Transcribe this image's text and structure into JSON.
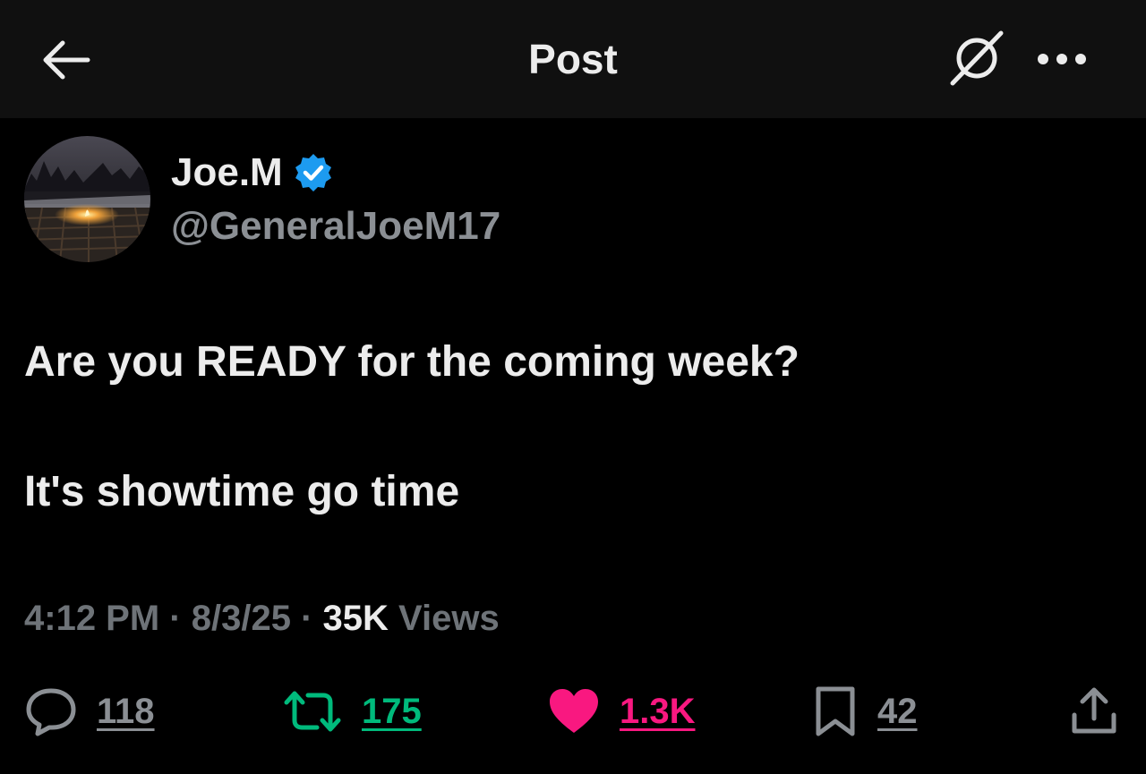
{
  "header": {
    "title": "Post",
    "back_icon": "arrow-left-icon",
    "grok_icon": "grok-slash-icon",
    "more_icon": "ellipsis-icon"
  },
  "author": {
    "display_name": "Joe.M",
    "handle": "@GeneralJoeM17",
    "verified": true,
    "verified_color": "#1d9bf0"
  },
  "post": {
    "line1": "Are you READY for the coming week?",
    "line2": "It's showtime go time"
  },
  "meta": {
    "time": "4:12 PM",
    "date": "8/3/25",
    "views_count": "35K",
    "views_label": "Views"
  },
  "actions": {
    "replies": {
      "count": "118",
      "color": "#8b8f94"
    },
    "reposts": {
      "count": "175",
      "color": "#00ba7c"
    },
    "likes": {
      "count": "1.3K",
      "color": "#f91880"
    },
    "bookmarks": {
      "count": "42",
      "color": "#8b8f94"
    }
  }
}
